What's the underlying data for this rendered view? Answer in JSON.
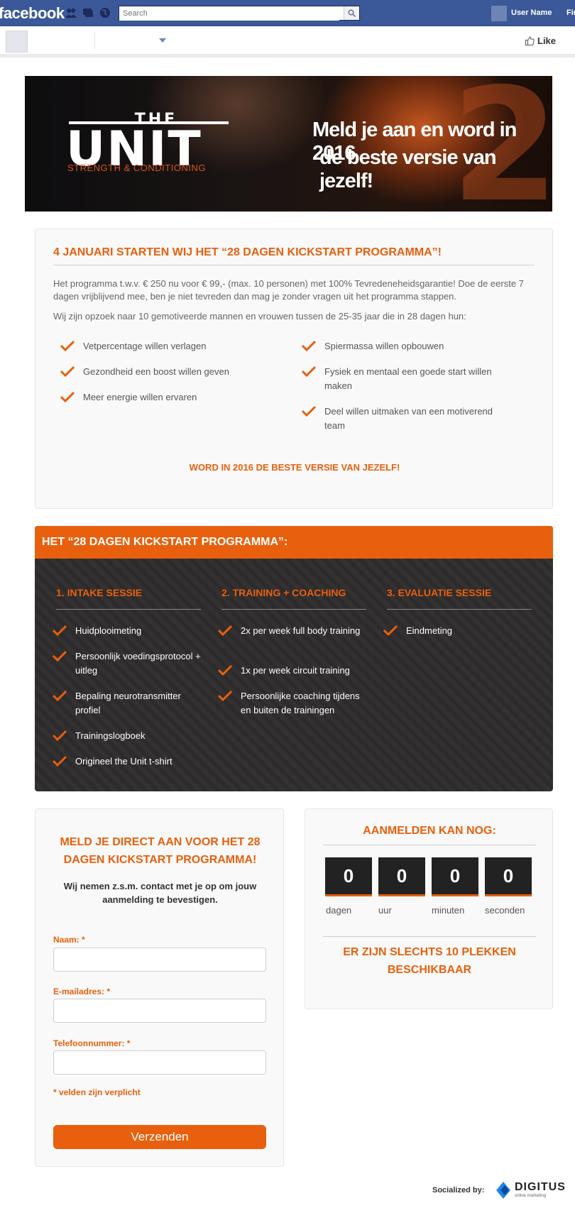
{
  "fb": {
    "logo": "facebook",
    "search_placeholder": "Search",
    "user_name": "User Name",
    "find_partial": "Fir"
  },
  "page": {
    "like_label": "Like"
  },
  "banner": {
    "logo_the": "THE",
    "logo_unit": "UNIT",
    "logo_sub": "STRENGTH & CONDITIONING",
    "headline_line1": "Meld je aan en word in 2016",
    "headline_line2": "de beste versie van jezelf!"
  },
  "intro": {
    "title": "4 JANUARI STARTEN WIJ HET “28 DAGEN KICKSTART PROGRAMMA”!",
    "p1": "Het programma t.w.v. € 250 nu voor € 99,- (max. 10 personen) met 100% Tevredeneheidsgarantie! Doe de eerste 7 dagen vrijblijvend mee, ben je niet tevreden dan mag je zonder vragen uit het programma stappen.",
    "p2": "Wij zijn opzoek naar 10 gemotiveerde mannen en vrouwen tussen de 25-35 jaar die in 28 dagen hun:",
    "left_items": [
      "Vetpercentage willen verlagen",
      "Gezondheid een boost willen geven",
      "Meer energie willen ervaren"
    ],
    "right_items": [
      "Spiermassa willen opbouwen",
      "Fysiek en mentaal een goede start willen maken",
      "Deel willen uitmaken van een motiverend team"
    ],
    "cta": "WORD IN 2016 DE BESTE VERSIE VAN JEZELF!"
  },
  "program": {
    "header": "HET “28 DAGEN KICKSTART PROGRAMMA”:",
    "columns": [
      {
        "title": "1. INTAKE SESSIE",
        "items": [
          "Huidplooimeting",
          "Persoonlijk voedingsprotocol + uitleg",
          "Bepaling neurotransmitter profiel",
          "Trainingslogboek",
          "Origineel the Unit t-shirt"
        ]
      },
      {
        "title": "2. TRAINING + COACHING",
        "items": [
          "2x per week full body training",
          "1x per week circuit training",
          "Persoonlijke coaching tijdens en buiten de trainingen"
        ]
      },
      {
        "title": "3. EVALUATIE SESSIE",
        "items": [
          "Eindmeting"
        ]
      }
    ]
  },
  "form": {
    "title": "MELD JE DIRECT AAN VOOR HET 28 DAGEN KICKSTART PROGRAMMA!",
    "subtitle": "Wij nemen z.s.m. contact met je op om jouw aanmelding te bevestigen.",
    "name_label": "Naam: *",
    "email_label": "E-mailadres: *",
    "phone_label": "Telefoonnummer: *",
    "required_note": "* velden zijn verplicht",
    "submit_label": "Verzenden"
  },
  "countdown": {
    "title": "AANMELDEN KAN NOG:",
    "values": {
      "days": "0",
      "hours": "0",
      "minutes": "0",
      "seconds": "0"
    },
    "labels": {
      "days": "dagen",
      "hours": "uur",
      "minutes": "minuten",
      "seconds": "seconden"
    },
    "footer": "ER ZIJN SLECHTS 10 PLEKKEN BESCHIKBAAR"
  },
  "footer": {
    "socialized_by": "Socialized by:",
    "brand": "DIGITUS",
    "brand_sub": "online marketing"
  },
  "colors": {
    "accent": "#e8600e",
    "fb_blue": "#3b5998",
    "dark_panel": "#2d2b2b"
  }
}
